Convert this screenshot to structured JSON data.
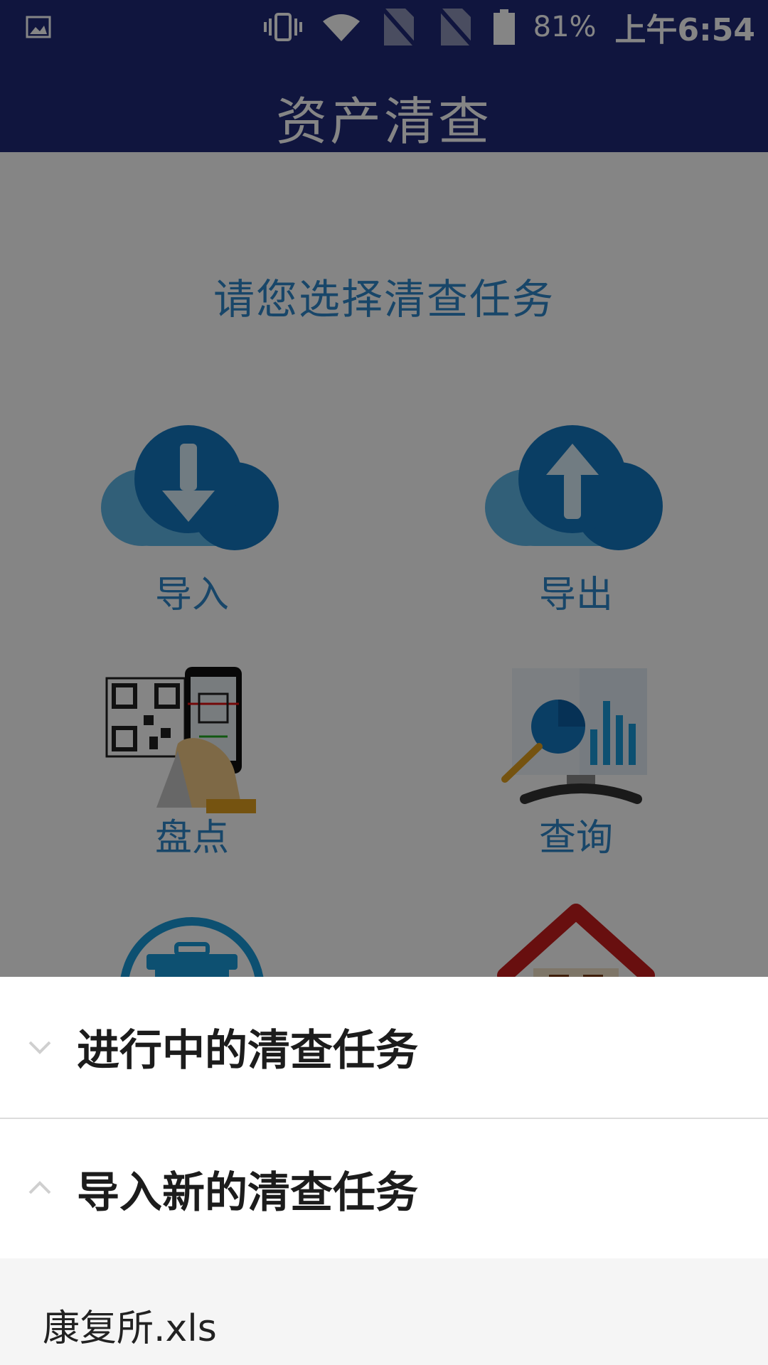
{
  "status_bar": {
    "battery": "81%",
    "time": "上午6:54",
    "icons": [
      "image-icon",
      "vibrate-icon",
      "wifi-icon",
      "no-sim-icon",
      "no-sim-icon",
      "battery-icon"
    ]
  },
  "app_bar": {
    "title": "资产清查"
  },
  "main": {
    "prompt": "请您选择清查任务",
    "tiles": [
      {
        "label": "导入",
        "icon": "cloud-download-icon"
      },
      {
        "label": "导出",
        "icon": "cloud-upload-icon"
      },
      {
        "label": "盘点",
        "icon": "qr-scan-icon"
      },
      {
        "label": "查询",
        "icon": "search-chart-icon"
      }
    ],
    "extra_icons": [
      "trash-icon",
      "home-icon"
    ]
  },
  "sheet": {
    "items": [
      {
        "label": "进行中的清查任务",
        "expanded": false
      },
      {
        "label": "导入新的清查任务",
        "expanded": true
      }
    ],
    "files": [
      "康复所.xls"
    ]
  },
  "colors": {
    "app_bar": "#202a78",
    "accent_blue": "#2f87c9",
    "overlay": "rgba(0,0,0,0.48)",
    "sheet_bg": "#ffffff",
    "file_bg": "#f5f5f5"
  }
}
